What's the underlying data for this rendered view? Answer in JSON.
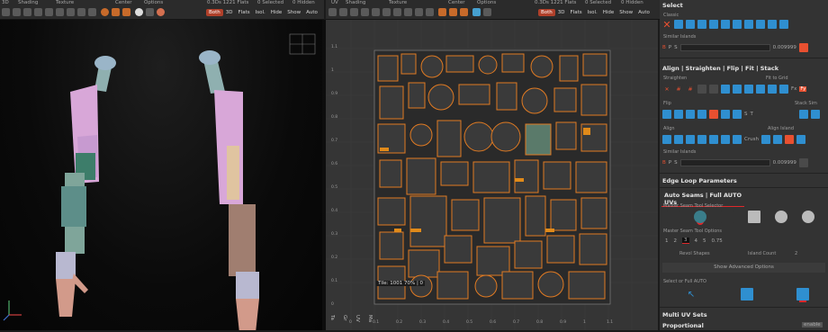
{
  "left_toolbar": {
    "items": [
      {
        "label": "3D"
      },
      {
        "label": "Shading"
      },
      {
        "label": "Texture"
      },
      {
        "label": "Center"
      },
      {
        "label": "Options"
      }
    ],
    "stats": "0.3Ds 1221 Flats",
    "selected": "0 Selected",
    "hidden": "0 Hidden",
    "buttons": [
      "Both",
      "3D",
      "Flats",
      "Isol.",
      "Hide",
      "Show",
      "Auto"
    ]
  },
  "uv_toolbar": {
    "items": [
      {
        "label": "UV"
      },
      {
        "label": "Shading"
      },
      {
        "label": "Texture"
      },
      {
        "label": "Center"
      },
      {
        "label": "Options"
      }
    ],
    "stats": "0.3Ds 1221 Flats",
    "selected": "0 Selected",
    "hidden": "0 Hidden",
    "buttons": [
      "Both",
      "3D",
      "Flats",
      "Isol.",
      "Hide",
      "Show",
      "Auto"
    ]
  },
  "uv_status": "Tile: 1001 70% | 0",
  "uv_ticks_x": [
    "0",
    "0.1",
    "0.2",
    "0.3",
    "0.4",
    "0.5",
    "0.6",
    "0.7",
    "0.8",
    "0.9",
    "1",
    "1.1"
  ],
  "uv_ticks_y": [
    "1.1",
    "1",
    "0.9",
    "0.8",
    "0.7",
    "0.6",
    "0.5",
    "0.4",
    "0.3",
    "0.2",
    "0.1",
    "0"
  ],
  "left_vtabs": [
    "Ta",
    "Gr",
    "UV",
    "Ma"
  ],
  "panel": {
    "select_title": "Select",
    "classic_label": "Classic",
    "similar_label": "Similar Islands",
    "bps": [
      "B",
      "P",
      "S"
    ],
    "threshold": "0.009999",
    "align_title": "Align | Straighten | Flip | Fit | Stack",
    "straighten_label": "Straighten",
    "fit_label": "Fit to Grid",
    "flip_label": "Flip",
    "stacksim_label": "Stack Sim",
    "align_label": "Align",
    "align_island_label": "Align Island",
    "crush_label": "Crush",
    "ft_labels": [
      "Fx",
      "Fy",
      "S",
      "T"
    ],
    "similar2_label": "Similar Islands",
    "threshold2": "0.009999",
    "edgeloop_title": "Edge Loop Parameters",
    "autoseams_title": "Auto Seams | Full AUTO UVs",
    "master_seam_label": "Master Seam Tool Selector",
    "master_opts_label": "Master Seam Tool Options",
    "opts_numbers": [
      "1",
      "2",
      "3",
      "4",
      "5",
      "0.75"
    ],
    "revol_label": "Revol Shapes",
    "island_count_label": "Island Count",
    "island_count": "2",
    "show_adv": "Show Advanced Options",
    "select_full_label": "Select or Full AUTO",
    "multi_uv_title": "Multi UV Sets",
    "proportional_title": "Proportional",
    "proportional_badge": "enable"
  },
  "colors": {
    "accent": "#d9602a",
    "blue": "#2f8fd0",
    "red_under": "#e0282a",
    "seam": "#e07a22"
  }
}
